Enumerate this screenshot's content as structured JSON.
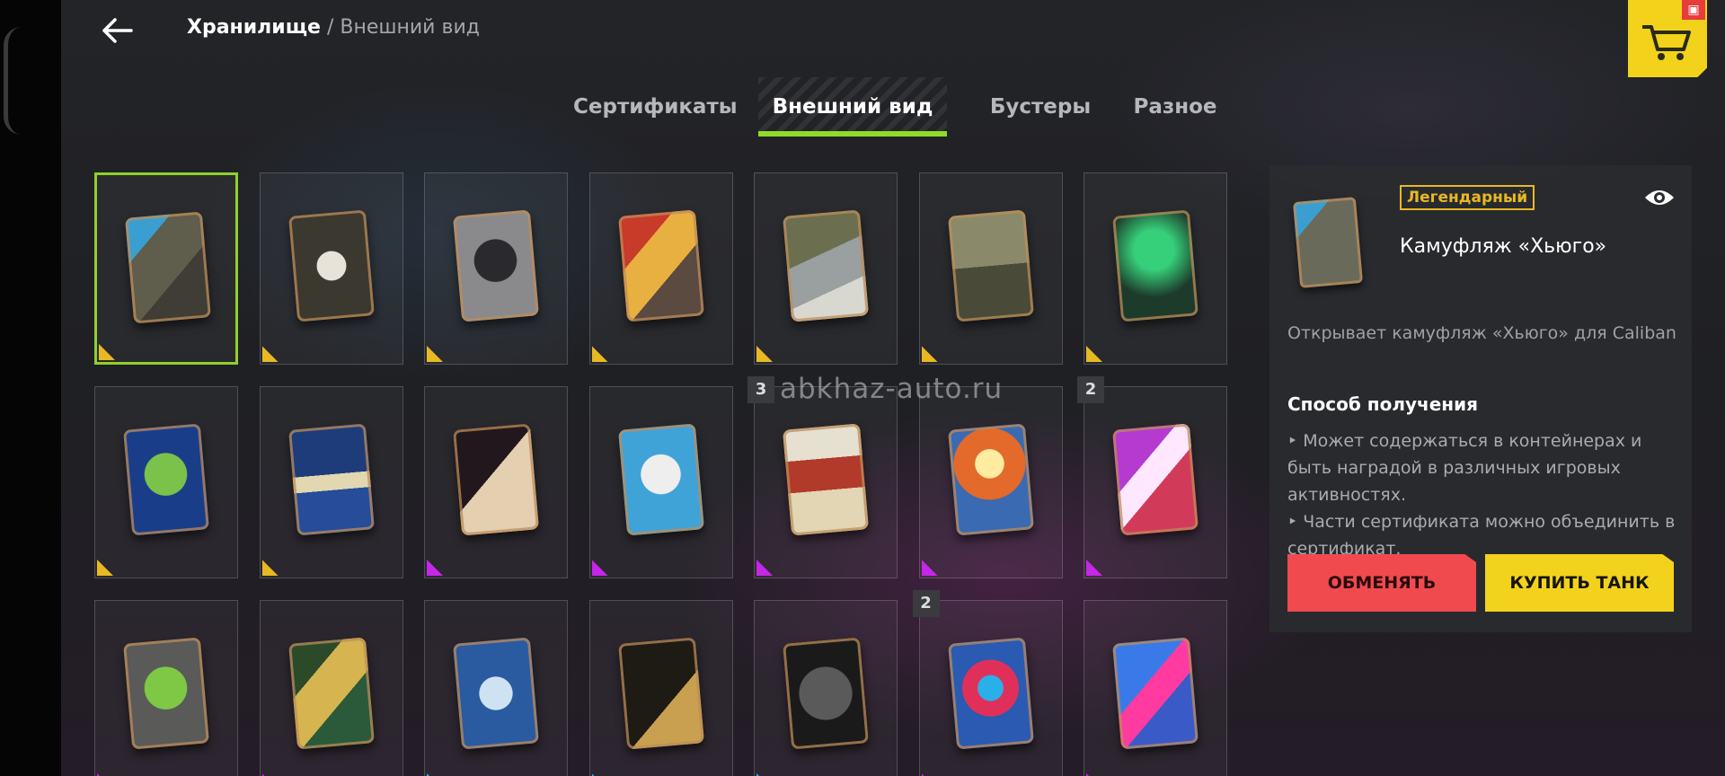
{
  "breadcrumb": {
    "current": "Хранилище",
    "separator": " / ",
    "sub": "Внешний вид"
  },
  "tabs": [
    {
      "label": "Сертификаты",
      "active": false
    },
    {
      "label": "Внешний вид",
      "active": true
    },
    {
      "label": "Бустеры",
      "active": false
    },
    {
      "label": "Разное",
      "active": false
    }
  ],
  "shop": {
    "icon": "cart-icon",
    "badge_icon": "gift-icon"
  },
  "watermark": "abkhaz-auto.ru",
  "colors": {
    "accent": "#8fdc26",
    "legendary": "#e8b923",
    "epic": "#c526e8",
    "rare": "#2ab0e8",
    "exchange": "#f04a4f",
    "buy": "#f3d21d"
  },
  "grid": {
    "items": [
      {
        "name": "camo-hugo",
        "rarity": "legendary",
        "count": "",
        "selected": true
      },
      {
        "name": "bear-emblem",
        "rarity": "legendary",
        "count": ""
      },
      {
        "name": "demon-emblem",
        "rarity": "legendary",
        "count": ""
      },
      {
        "name": "shield-emblem",
        "rarity": "legendary",
        "count": ""
      },
      {
        "name": "letter-k-camo",
        "rarity": "legendary",
        "count": ""
      },
      {
        "name": "wasp-camo",
        "rarity": "legendary",
        "count": ""
      },
      {
        "name": "wizard-camo",
        "rarity": "legendary",
        "count": ""
      },
      {
        "name": "christmas-tree-camo",
        "rarity": "legendary",
        "count": ""
      },
      {
        "name": "plane-camo",
        "rarity": "legendary",
        "count": ""
      },
      {
        "name": "dark-waves-camo",
        "rarity": "epic",
        "count": ""
      },
      {
        "name": "snowman-camo",
        "rarity": "epic",
        "count": ""
      },
      {
        "name": "train-camo",
        "rarity": "epic",
        "count": "3"
      },
      {
        "name": "sunset-camo",
        "rarity": "epic",
        "count": ""
      },
      {
        "name": "eye-camo",
        "rarity": "epic",
        "count": "2"
      },
      {
        "name": "circuit-camo",
        "rarity": "epic",
        "count": ""
      },
      {
        "name": "map-camo",
        "rarity": "epic",
        "count": ""
      },
      {
        "name": "crackle-camo",
        "rarity": "rare",
        "count": ""
      },
      {
        "name": "gold-lines-camo",
        "rarity": "rare",
        "count": ""
      },
      {
        "name": "hex-camo",
        "rarity": "rare",
        "count": ""
      },
      {
        "name": "target-camo",
        "rarity": "epic",
        "count": "2"
      },
      {
        "name": "stickers-camo",
        "rarity": "epic",
        "count": ""
      }
    ]
  },
  "panel": {
    "rarity": "Легендарный",
    "name": "Камуфляж «Хьюго»",
    "description": "Открывает камуфляж «Хьюго» для Caliban",
    "how_title": "Способ получения",
    "bullets": [
      "Может содержаться в контейнерах и быть наградой в различных игровых активностях.",
      "Части сертификата можно объединить в сертификат."
    ],
    "exchange_label": "ОБМЕНЯТЬ",
    "buy_label": "КУПИТЬ ТАНК"
  }
}
